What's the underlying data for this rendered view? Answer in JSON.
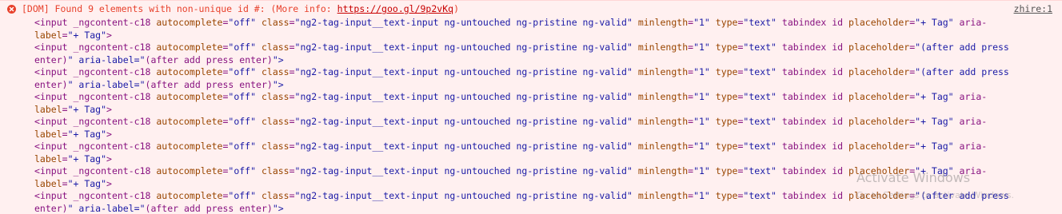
{
  "message": {
    "prefix": "[DOM] Found 9 elements with non-unique id #: (More info: ",
    "link": "https://goo.gl/9p2vKq",
    "suffix": ")",
    "source": "zhire:1"
  },
  "lines": [
    "<input _ngcontent-c18 autocomplete=\"off\" class=\"ng2-tag-input__text-input ng-untouched ng-pristine ng-valid\" minlength=\"1\" type=\"text\" tabindex id placeholder=\"+ Tag\" aria-",
    "label=\"+ Tag\">",
    "<input _ngcontent-c18 autocomplete=\"off\" class=\"ng2-tag-input__text-input ng-untouched ng-pristine ng-valid\" minlength=\"1\" type=\"text\" tabindex id placeholder=\"(after add press",
    "enter)\" aria-label=\"(after add press enter)\">",
    "<input _ngcontent-c18 autocomplete=\"off\" class=\"ng2-tag-input__text-input ng-untouched ng-pristine ng-valid\" minlength=\"1\" type=\"text\" tabindex id placeholder=\"(after add press",
    "enter)\" aria-label=\"(after add press enter)\">",
    "<input _ngcontent-c18 autocomplete=\"off\" class=\"ng2-tag-input__text-input ng-untouched ng-pristine ng-valid\" minlength=\"1\" type=\"text\" tabindex id placeholder=\"+ Tag\" aria-",
    "label=\"+ Tag\">",
    "<input _ngcontent-c18 autocomplete=\"off\" class=\"ng2-tag-input__text-input ng-untouched ng-pristine ng-valid\" minlength=\"1\" type=\"text\" tabindex id placeholder=\"+ Tag\" aria-",
    "label=\"+ Tag\">",
    "<input _ngcontent-c18 autocomplete=\"off\" class=\"ng2-tag-input__text-input ng-untouched ng-pristine ng-valid\" minlength=\"1\" type=\"text\" tabindex id placeholder=\"+ Tag\" aria-",
    "label=\"+ Tag\">",
    "<input _ngcontent-c18 autocomplete=\"off\" class=\"ng2-tag-input__text-input ng-untouched ng-pristine ng-valid\" minlength=\"1\" type=\"text\" tabindex id placeholder=\"+ Tag\" aria-",
    "label=\"+ Tag\">",
    "<input _ngcontent-c18 autocomplete=\"off\" class=\"ng2-tag-input__text-input ng-untouched ng-pristine ng-valid\" minlength=\"1\" type=\"text\" tabindex id placeholder=\"(after add press",
    "enter)\" aria-label=\"(after add press enter)\">"
  ],
  "watermark": {
    "title": "Activate Windows",
    "subtitle": "Go to Settings to activate Windows."
  },
  "colors": {
    "error": "#e8412c",
    "background": "#fff0f0",
    "tag": "#881280",
    "value": "#1a1aa6"
  },
  "icons": {
    "error": "error-circle-icon"
  }
}
